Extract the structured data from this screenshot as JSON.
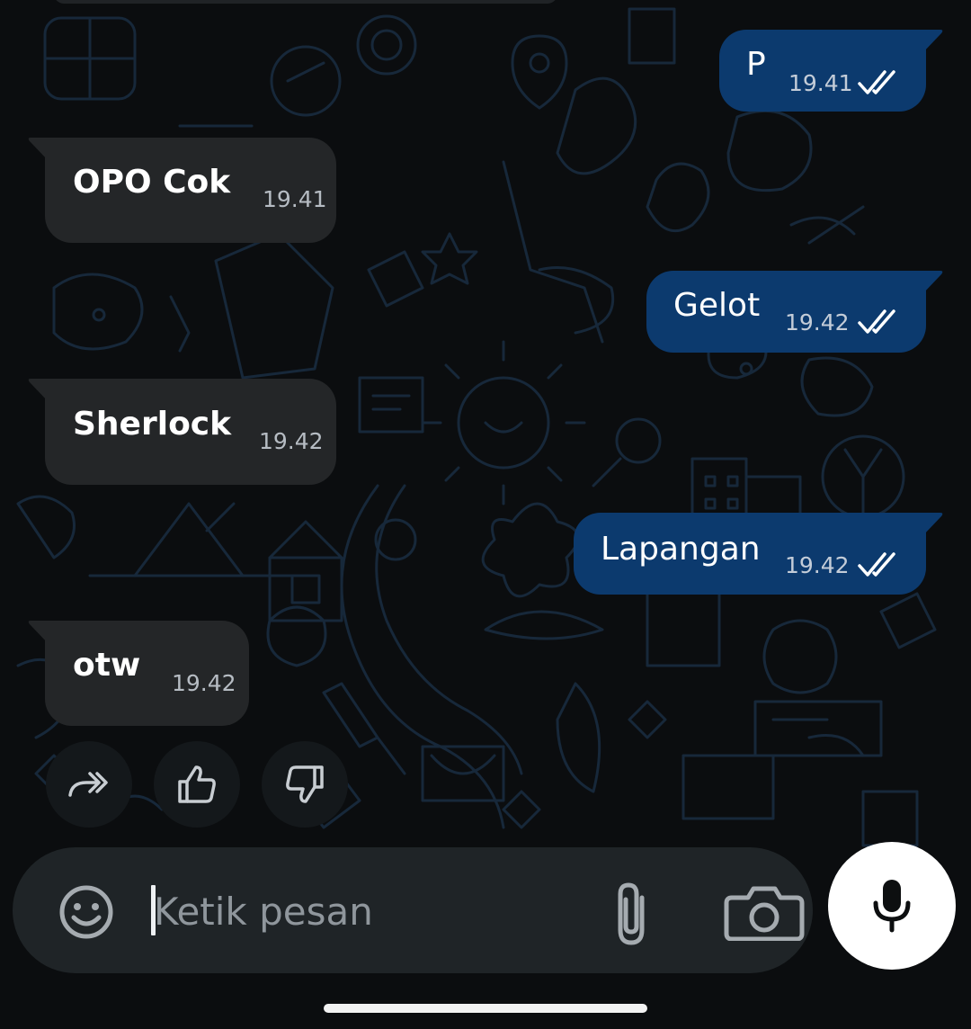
{
  "messages": [
    {
      "direction": "outgoing",
      "text": "P",
      "time": "19.41",
      "status": "read",
      "tick_icon": "double-check-icon"
    },
    {
      "direction": "incoming",
      "text": "OPO Cok",
      "time": "19.41"
    },
    {
      "direction": "outgoing",
      "text": "Gelot",
      "time": "19.42",
      "status": "read",
      "tick_icon": "double-check-icon"
    },
    {
      "direction": "incoming",
      "text": "Sherlock",
      "time": "19.42"
    },
    {
      "direction": "outgoing",
      "text": "Lapangan",
      "time": "19.42",
      "status": "read",
      "tick_icon": "double-check-icon"
    },
    {
      "direction": "incoming",
      "text": "otw",
      "time": "19.42"
    }
  ],
  "quick_actions": [
    {
      "icon": "forward-icon",
      "action": "forward"
    },
    {
      "icon": "thumbs-up-icon",
      "action": "good-response"
    },
    {
      "icon": "thumbs-down-icon",
      "action": "bad-response"
    }
  ],
  "composer": {
    "placeholder": "Ketik pesan",
    "value": "",
    "emoji_icon": "emoji-icon",
    "attach_icon": "paperclip-icon",
    "camera_icon": "camera-icon",
    "send_icon": "microphone-icon"
  },
  "colors": {
    "background": "#0b0d0f",
    "incoming_bubble": "#242628",
    "outgoing_bubble": "#0c3a6e",
    "composer": "#1f2427",
    "mic_button": "#ffffff"
  }
}
